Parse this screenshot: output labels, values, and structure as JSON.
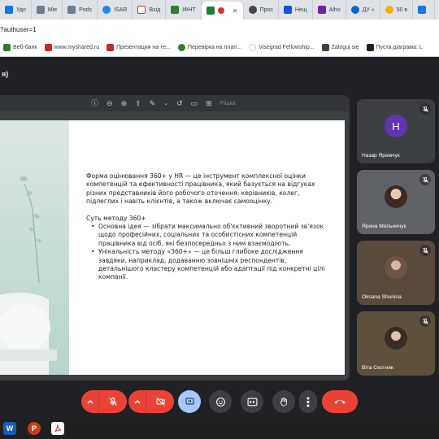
{
  "browser": {
    "tabs": [
      {
        "label": "Удо",
        "color": "#1a73e8"
      },
      {
        "label": "Mie",
        "color": "#6b7e8f"
      },
      {
        "label": "Pods",
        "color": "#6b7e8f"
      },
      {
        "label": "ISAR",
        "color": "#1e88e5"
      },
      {
        "label": "Вхід",
        "color": "#d93025"
      },
      {
        "label": "ІФНТ",
        "color": "#2e7d32"
      },
      {
        "label": "",
        "color": "#188038",
        "active": true
      },
      {
        "label": "Прос",
        "color": "#444746"
      },
      {
        "label": "Нещ",
        "color": "#0b57d0"
      },
      {
        "label": "Aiho",
        "color": "#7b1fa2"
      },
      {
        "label": "ДУ «",
        "color": "#1565c0"
      },
      {
        "label": "50 в",
        "color": "#f9ab00"
      },
      {
        "label": "",
        "color": "#1a73e8"
      }
    ],
    "url": "?authuser=1",
    "bookmarks": [
      {
        "label": "Веб-банк",
        "color": "#2e7d32"
      },
      {
        "label": "www.myshared.ru",
        "color": "#c62828"
      },
      {
        "label": "Презентация на те...",
        "color": "#c62828"
      },
      {
        "label": "Перевірка на плагі...",
        "color": "#2e7d32"
      },
      {
        "label": "Visegrad Fellowship...",
        "color": "#9e9e9e"
      },
      {
        "label": "Zaloguj się",
        "color": "#3c4043"
      },
      {
        "label": "Пуста діаграма: L",
        "color": "#202124"
      }
    ]
  },
  "meet": {
    "title_fragment": "я)",
    "pdf_toolbar": {
      "icons": [
        "info-icon",
        "zoom-out-icon",
        "zoom-in-icon",
        "share-icon",
        "draw-icon",
        "chevron-down-icon",
        "undo-icon",
        "comment-icon",
        "comment-add-icon"
      ],
      "open_label": "Рішка"
    },
    "slide": {
      "paragraph": "Форма оцінювання 360+ у HR — це інструмент комплексної оцінки компетенцій та ефективності працівника, який базується на відгуках різних представників його робочого оточення: керівників, колег, підлеглих і навіть клієнтів, а також включає самооцінку.",
      "subheading": "Суть методу 360+",
      "bullets": [
        "Основна ідея — зібрати максимально об'єктивний зворотний зв'язок щодо професійних, соціальних та особистісних компетенцій працівника від осіб, які безпосередньо з ним взаємодіють.",
        "Унікальність методу «360+» — це більш глибоке дослідження завдяки, наприклад, додаванню зовнішніх респондентів, детальнішого кластеру компетенцій або адаптації під конкретні цілі компанії."
      ]
    },
    "participants": [
      {
        "name": "Назар Яремчук",
        "initial": "H",
        "bg": "#3c4043"
      },
      {
        "name": "Ярина Мельничук",
        "initial": "",
        "bg": "#5f6368"
      },
      {
        "name": "Oksana Shunina",
        "initial": "",
        "bg": "#5a4a3e"
      },
      {
        "name": "Віта Скотник",
        "initial": "",
        "bg": "#5d503c"
      }
    ],
    "controls": {
      "mic": "mic-off-icon",
      "camera": "camera-off-icon",
      "present": "present-icon",
      "emoji": "emoji-icon",
      "captions": "captions-icon",
      "hand": "raise-hand-icon",
      "more": "more-icon",
      "hangup": "hangup-icon",
      "accent": "#ea4335"
    }
  },
  "taskbar": {
    "apps": [
      {
        "name": "Word",
        "glyph": "W",
        "color": "#185abd"
      },
      {
        "name": "PowerPoint",
        "glyph": "P",
        "color": "#c43e1c"
      },
      {
        "name": "PDF",
        "glyph": "",
        "color": "#d32f2f"
      }
    ]
  }
}
